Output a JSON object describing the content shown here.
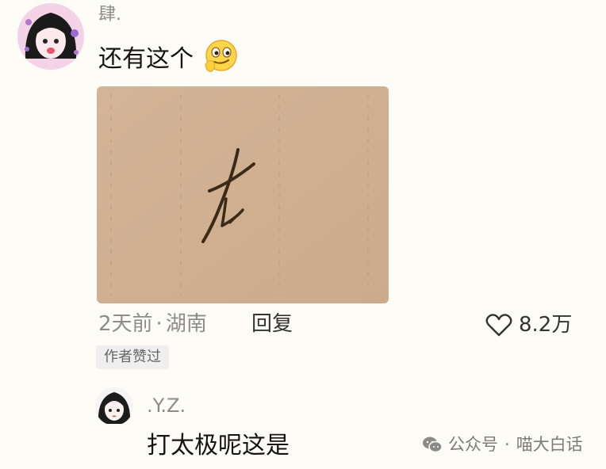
{
  "comment": {
    "username": "肆.",
    "text": "还有这个",
    "emoji": "smirk-emoji",
    "time": "2天前",
    "separator": "·",
    "location": "湖南",
    "reply_label": "回复",
    "likes": "8.2万",
    "badge": "作者赞过"
  },
  "reply": {
    "username": ".Y.Z.",
    "text": "打太极呢这是"
  },
  "watermark": {
    "channel": "公众号",
    "separator": "·",
    "name": "喵大白话"
  },
  "colors": {
    "background": "#fdfcf7",
    "meta_text": "#8c8c8c",
    "badge_bg": "#efefef",
    "paper": "#d2b292",
    "ink": "#3b2a18"
  }
}
